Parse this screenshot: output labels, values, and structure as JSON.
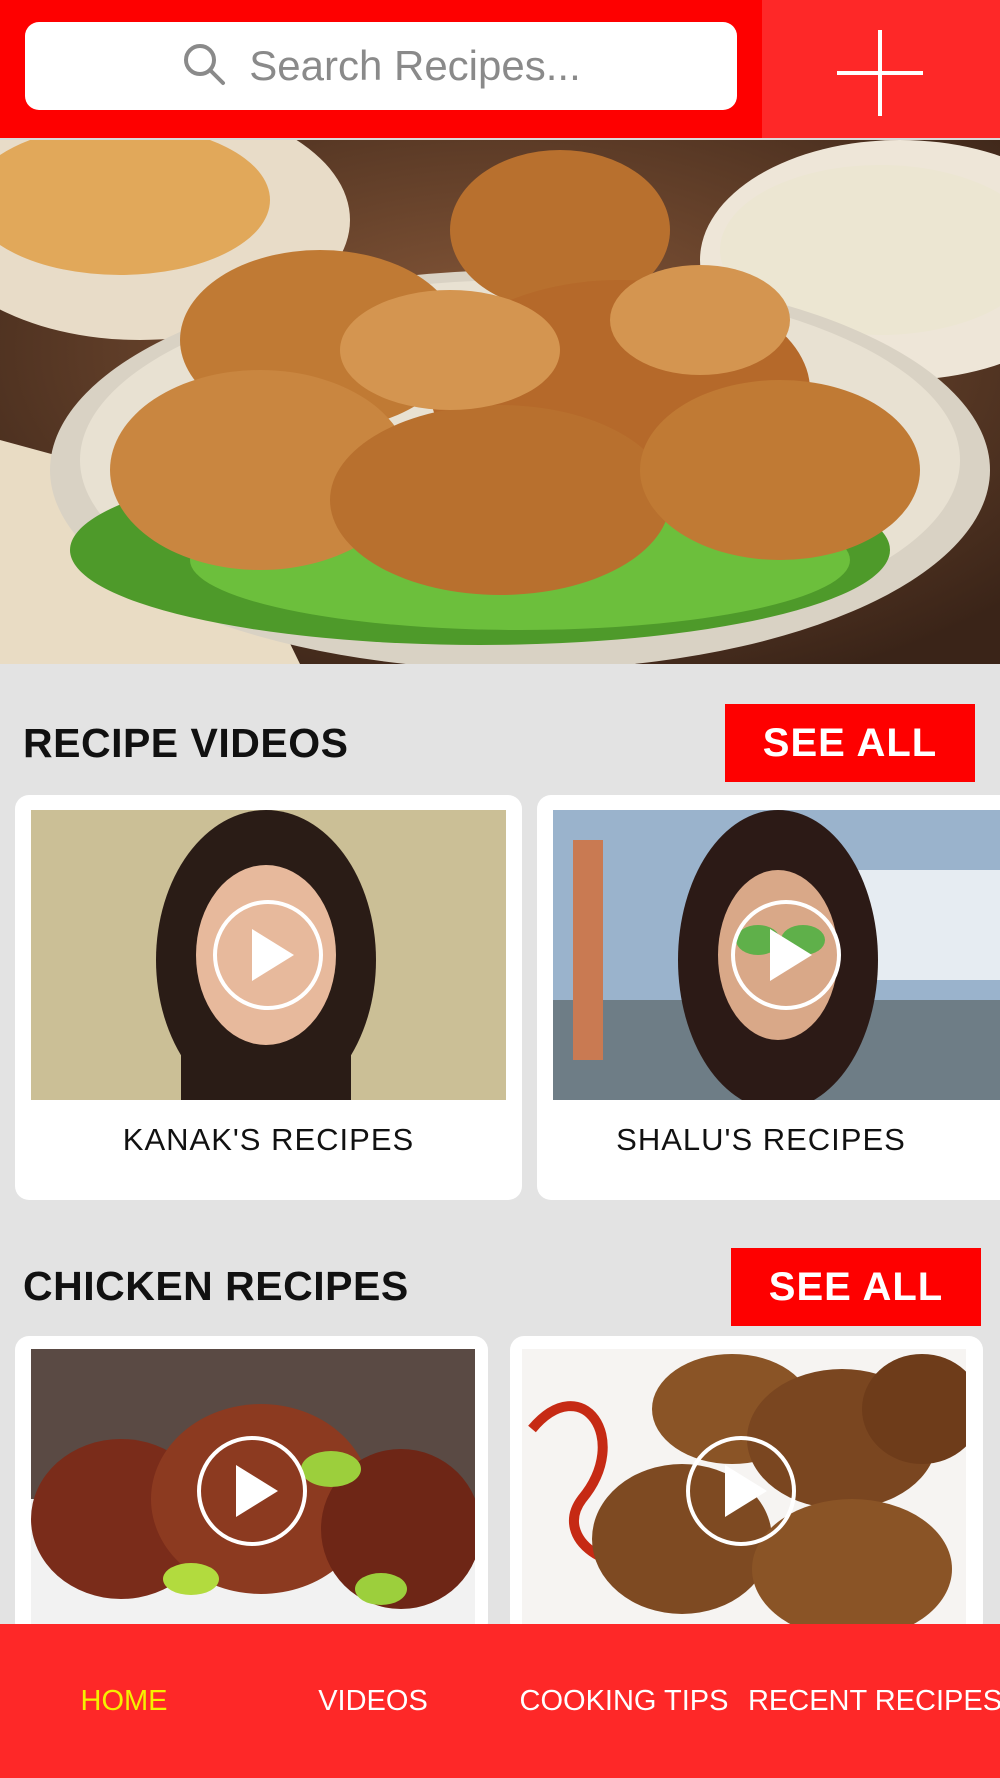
{
  "search": {
    "placeholder": "Search Recipes..."
  },
  "sections": [
    {
      "title": "RECIPE VIDEOS",
      "see_all_label": "SEE ALL",
      "cards": [
        {
          "label": "KANAK'S RECIPES"
        },
        {
          "label": "SHALU'S RECIPES"
        }
      ]
    },
    {
      "title": "CHICKEN RECIPES",
      "see_all_label": "SEE ALL",
      "cards": [
        {
          "label": ""
        },
        {
          "label": ""
        }
      ]
    }
  ],
  "nav": {
    "items": [
      {
        "label": "HOME",
        "active": true
      },
      {
        "label": "VIDEOS",
        "active": false
      },
      {
        "label": "COOKING TIPS",
        "active": false
      },
      {
        "label": "RECENT RECIPES",
        "active": false
      }
    ]
  },
  "colors": {
    "brand_red": "#fe0000",
    "active_nav": "#f5f000"
  }
}
